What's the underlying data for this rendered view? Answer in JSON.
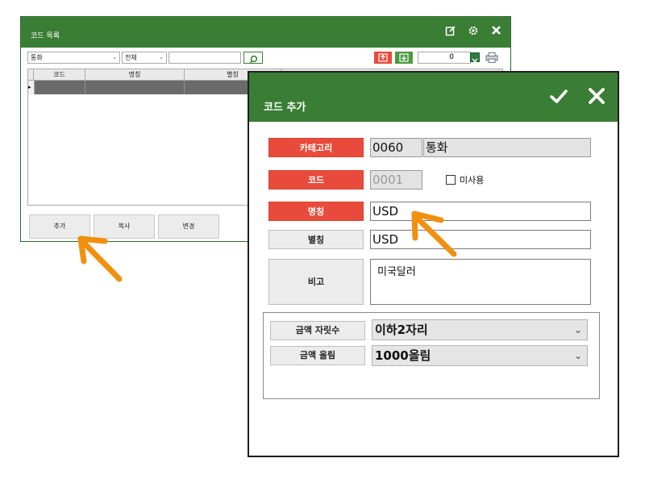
{
  "code_list": {
    "title": "코드 목록",
    "category_select": "통화",
    "scope_select": "전체",
    "search_value": "",
    "count": "0",
    "columns": [
      "코드",
      "명칭",
      "별칭"
    ],
    "buttons": {
      "add": "추가",
      "copy": "복사",
      "change": "변경"
    }
  },
  "code_add": {
    "title": "코드 추가",
    "category_label": "카테고리",
    "category_code": "0060",
    "category_name": "통화",
    "code_label": "코드",
    "code_value": "0001",
    "unused_label": "미사용",
    "name_label": "명칭",
    "name_value": "USD",
    "alias_label": "별칭",
    "alias_value": "USD",
    "memo_label": "비고",
    "memo_value": "미국달러",
    "amount_digits_label": "금액 자릿수",
    "amount_digits_value": "이하2자리",
    "amount_round_label": "금액 올림",
    "amount_round_value": "1000올림"
  },
  "colors": {
    "green": "#3a7d34",
    "red": "#e84b3c",
    "annotation": "#f0900e"
  }
}
